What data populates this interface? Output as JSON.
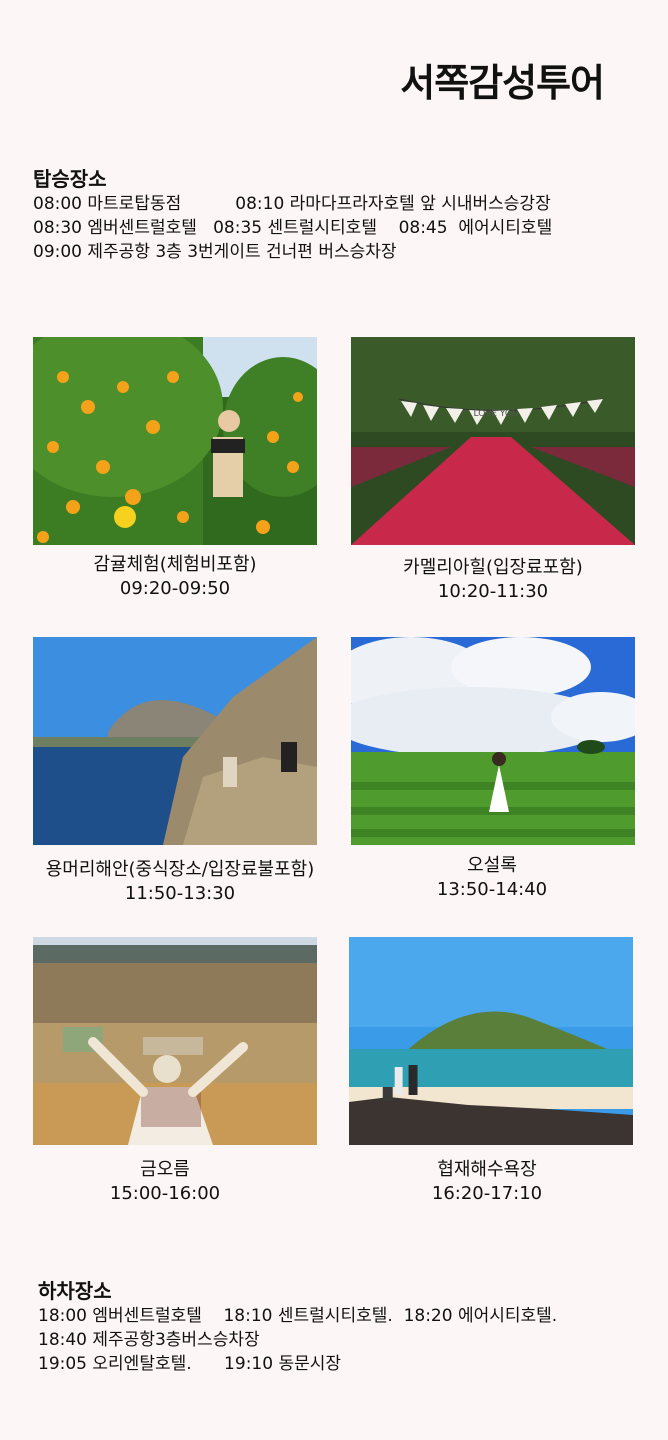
{
  "title": "서쪽감성투어",
  "pickup": {
    "heading": "탑승장소",
    "lines": [
      "08:00 마트로탑동점          08:10 라마다프라자호텔 앞 시내버스승강장",
      "08:30 엠버센트럴호텔   08:35 센트럴시티호텔    08:45  에어시티호텔",
      "09:00 제주공항 3층 3번게이트 건너편 버스승차장"
    ]
  },
  "stops": [
    {
      "name": "감귤체험(체험비포함)",
      "time": "09:20-09:50"
    },
    {
      "name": "카멜리아힐(입장료포함)",
      "time": "10:20-11:30"
    },
    {
      "name": "용머리해안(중식장소/입장료불포함)",
      "time": "11:50-13:30"
    },
    {
      "name": "오설록",
      "time": "13:50-14:40"
    },
    {
      "name": "금오름",
      "time": "15:00-16:00"
    },
    {
      "name": "협재해수욕장",
      "time": "16:20-17:10"
    }
  ],
  "banner_text": "LOVE YOU",
  "dropoff": {
    "heading": "하차장소",
    "lines": [
      "18:00 엠버센트럴호텔    18:10 센트럴시티호텔.  18:20 에어시티호텔.",
      "18:40 제주공항3층버스승차장",
      "19:05 오리엔탈호텔.      19:10 동문시장"
    ]
  }
}
